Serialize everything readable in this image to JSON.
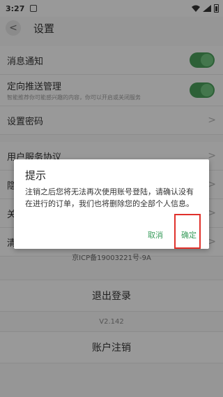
{
  "status_bar": {
    "time": "3:27"
  },
  "header": {
    "back_glyph": "<",
    "title": "设置"
  },
  "rows": {
    "message_notify": "消息通知",
    "push_manage": "定向推送管理",
    "push_manage_sub": "智能推荐你可能感兴趣的内容，你可以开启或关闭服务",
    "set_password": "设置密码",
    "user_agreement": "用户服务协议",
    "row_hidden_1": "隐",
    "row_hidden_2": "关",
    "row_hidden_3": "清"
  },
  "icp": "京ICP备19003221号-9A",
  "logout_label": "退出登录",
  "version": "V2.142",
  "cancel_account_label": "账户注销",
  "dialog": {
    "title": "提示",
    "message": "注销之后您将无法再次使用账号登陆，请确认没有在进行的订单，我们也将删除您的全部个人信息。",
    "cancel": "取消",
    "confirm": "确定"
  },
  "colors": {
    "accent": "#3a9d5d",
    "highlight": "#e0312b",
    "toggle": "#4a9b5a"
  },
  "icons": [
    "back-icon",
    "chevron-right-icon",
    "wifi-icon",
    "signal-icon",
    "battery-icon"
  ]
}
